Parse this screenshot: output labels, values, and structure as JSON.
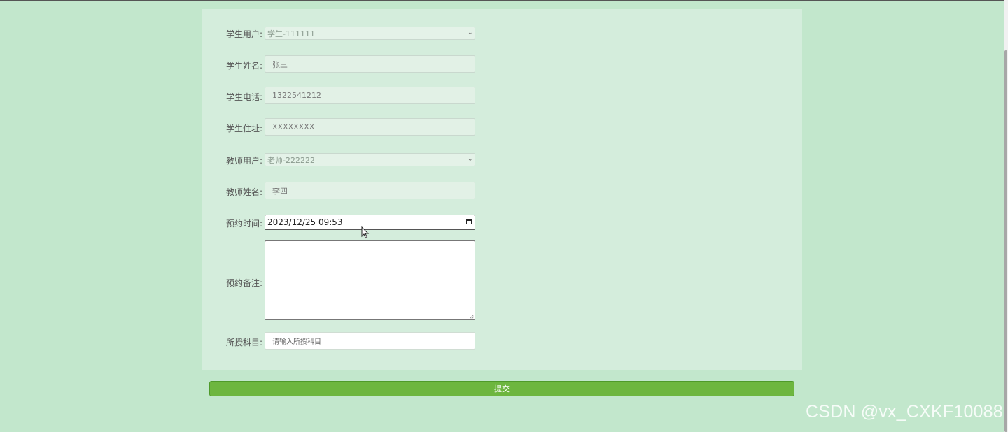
{
  "form": {
    "student_user": {
      "label": "学生用户:",
      "value": "学生-111111"
    },
    "student_name": {
      "label": "学生姓名:",
      "value": "张三"
    },
    "student_phone": {
      "label": "学生电话:",
      "value": "1322541212"
    },
    "student_address": {
      "label": "学生住址:",
      "value": "XXXXXXXX"
    },
    "teacher_user": {
      "label": "教师用户:",
      "value": "老师-222222"
    },
    "teacher_name": {
      "label": "教师姓名:",
      "value": "李四"
    },
    "appointment_time": {
      "label": "预约时间:",
      "value": "2023/12/25 09:53"
    },
    "appointment_note": {
      "label": "预约备注:",
      "value": ""
    },
    "subject": {
      "label": "所授科目:",
      "placeholder": "请输入所授科目"
    },
    "submit_label": "提交"
  },
  "watermark": "CSDN @vx_CXKF10088",
  "icons": {
    "select_arrow": "chevron-down-icon",
    "date_picker": "calendar-icon",
    "cursor": "mouse-pointer-icon"
  },
  "colors": {
    "page_background": "#c2e7cc",
    "panel_background": "#d4eddc",
    "submit_button": "#6db63f"
  }
}
